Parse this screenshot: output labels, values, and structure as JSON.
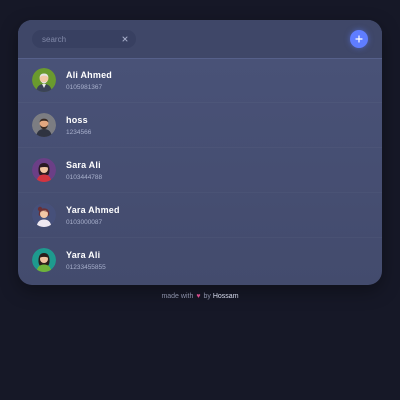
{
  "search": {
    "placeholder": "search",
    "value": ""
  },
  "contacts": [
    {
      "name": "Ali Ahmed",
      "phone": "0105981367",
      "avatar": "avatar-old-man"
    },
    {
      "name": "hoss",
      "phone": "1234566",
      "avatar": "avatar-bearded-man"
    },
    {
      "name": "Sara Ali",
      "phone": "0103444788",
      "avatar": "avatar-woman-red"
    },
    {
      "name": "Yara Ahmed",
      "phone": "0103000087",
      "avatar": "avatar-woman-purple"
    },
    {
      "name": "Yara Ali",
      "phone": "01233455855",
      "avatar": "avatar-woman-green"
    }
  ],
  "footer": {
    "made_with": "made with",
    "by": "by",
    "author": "Hossam"
  },
  "colors": {
    "background": "#161827",
    "card": "#4a5379",
    "accent": "#5f7dff",
    "heart": "#d64b8a"
  },
  "icons": {
    "add": "plus-icon",
    "clear": "close-icon",
    "heart": "heart-icon"
  }
}
